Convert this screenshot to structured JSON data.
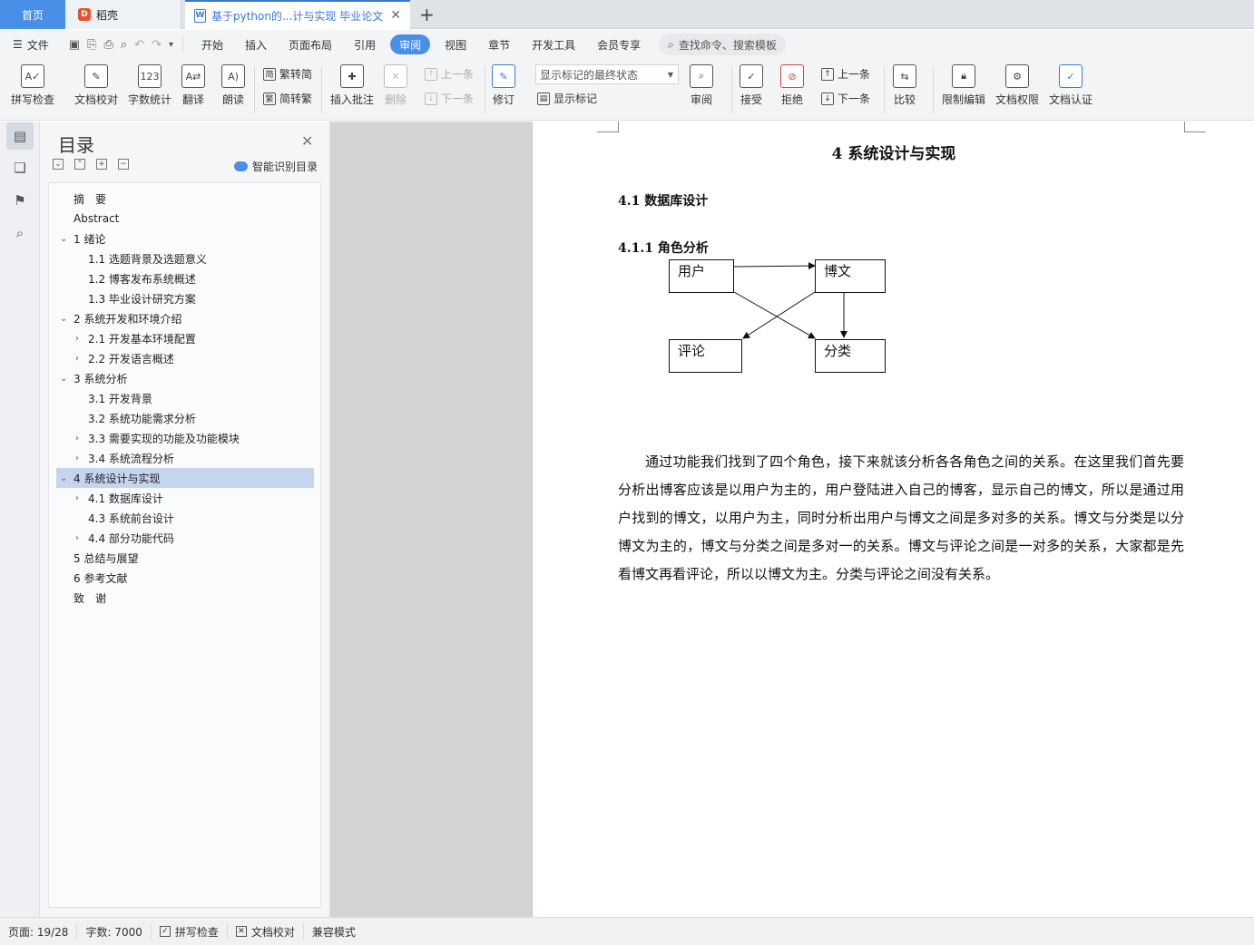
{
  "tabs": {
    "home": "首页",
    "daoke": "稻壳",
    "doc": "基于python的...计与实现 毕业论文"
  },
  "menu": {
    "file": "文件",
    "items": [
      "开始",
      "插入",
      "页面布局",
      "引用",
      "审阅",
      "视图",
      "章节",
      "开发工具",
      "会员专享"
    ],
    "active": "审阅",
    "search_placeholder": "查找命令、搜索模板"
  },
  "ribbon": {
    "spell": "拼写检查",
    "proof": "文档校对",
    "wordcount": "字数统计",
    "translate": "翻译",
    "read": "朗读",
    "t2s": "繁转简",
    "s2t": "简转繁",
    "insert_comment": "插入批注",
    "delete": "删除",
    "prev": "上一条",
    "next": "下一条",
    "revise": "修订",
    "markup_state": "显示标记的最终状态",
    "show_markup": "显示标记",
    "review": "审阅",
    "accept": "接受",
    "reject": "拒绝",
    "prev2": "上一条",
    "next2": "下一条",
    "compare": "比较",
    "restrict": "限制编辑",
    "permission": "文档权限",
    "certify": "文档认证"
  },
  "toc": {
    "title": "目录",
    "smart": "智能识别目录",
    "items": [
      {
        "label": "摘　要"
      },
      {
        "label": "Abstract"
      },
      {
        "label": "1 绪论"
      },
      {
        "label": "1.1 选题背景及选题意义"
      },
      {
        "label": "1.2  博客发布系统概述"
      },
      {
        "label": "1.3  毕业设计研究方案"
      },
      {
        "label": "2 系统开发和环境介绍"
      },
      {
        "label": "2.1 开发基本环境配置"
      },
      {
        "label": "2.2  开发语言概述"
      },
      {
        "label": "3 系统分析"
      },
      {
        "label": "3.1 开发背景"
      },
      {
        "label": "3.2 系统功能需求分析"
      },
      {
        "label": "3.3 需要实现的功能及功能模块"
      },
      {
        "label": "3.4 系统流程分析"
      },
      {
        "label": "4 系统设计与实现"
      },
      {
        "label": "4.1 数据库设计"
      },
      {
        "label": "4.3 系统前台设计"
      },
      {
        "label": "4.4 部分功能代码"
      },
      {
        "label": "5 总结与展望"
      },
      {
        "label": "6 参考文献"
      },
      {
        "label": "致　谢"
      }
    ]
  },
  "doc": {
    "chapter": "4 系统设计与实现",
    "section": "4.1 数据库设计",
    "subsection": "4.1.1  角色分析",
    "diagram": {
      "user": "用户",
      "post": "博文",
      "comment": "评论",
      "category": "分类"
    },
    "body": "通过功能我们找到了四个角色，接下来就该分析各各角色之间的关系。在这里我们首先要分析出博客应该是以用户为主的，用户登陆进入自己的博客，显示自己的博文，所以是通过用户找到的博文，以用户为主，同时分析出用户与博文之间是多对多的关系。博文与分类是以分博文为主的，博文与分类之间是多对一的关系。博文与评论之间是一对多的关系，大家都是先看博文再看评论，所以以博文为主。分类与评论之间没有关系。"
  },
  "status": {
    "page": "页面: 19/28",
    "words": "字数: 7000",
    "spell": "拼写检查",
    "proof": "文档校对",
    "compat": "兼容模式"
  }
}
